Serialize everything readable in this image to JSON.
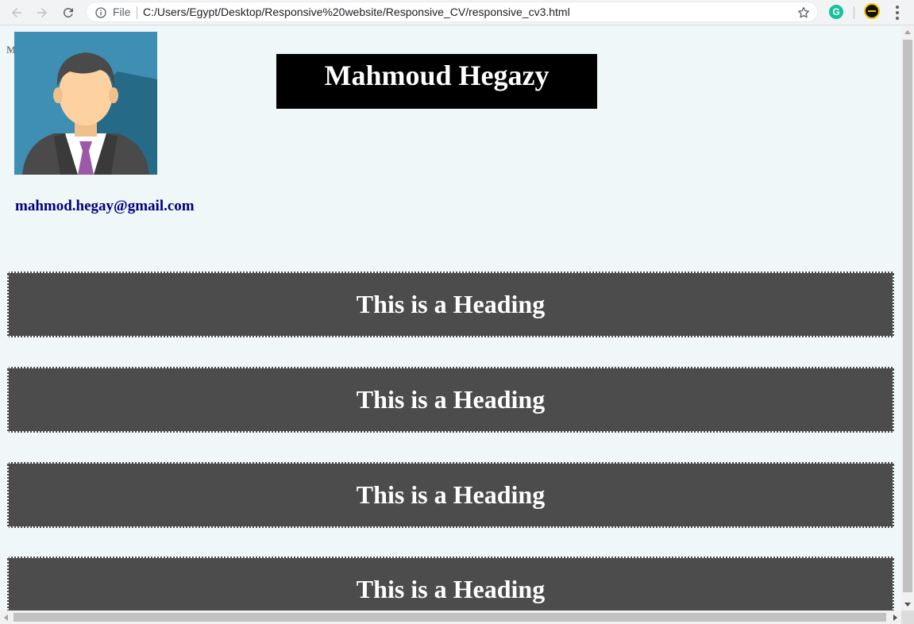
{
  "browser": {
    "scheme_label": "File",
    "url": "C:/Users/Egypt/Desktop/Responsive%20website/Responsive_CV/responsive_cv3.html",
    "extension_letter": "G",
    "icons": {
      "back": "arrow-left-icon",
      "forward": "arrow-right-icon",
      "reload": "reload-icon",
      "info": "info-icon",
      "bookmark": "star-icon",
      "grammarly": "grammarly-icon",
      "profile": "profile-avatar-icon",
      "menu": "more-vert-icon"
    }
  },
  "page": {
    "tiny_label": "M",
    "name": "Mahmoud Hegazy",
    "email": "mahmod.hegay@gmail.com",
    "headings": [
      "This is a Heading",
      "This is a Heading",
      "This is a Heading",
      "This is a Heading"
    ],
    "colors": {
      "page_background": "#eff7f9",
      "name_box": "#000000",
      "heading_box": "#4c4c4c",
      "email_text": "#000080"
    }
  }
}
